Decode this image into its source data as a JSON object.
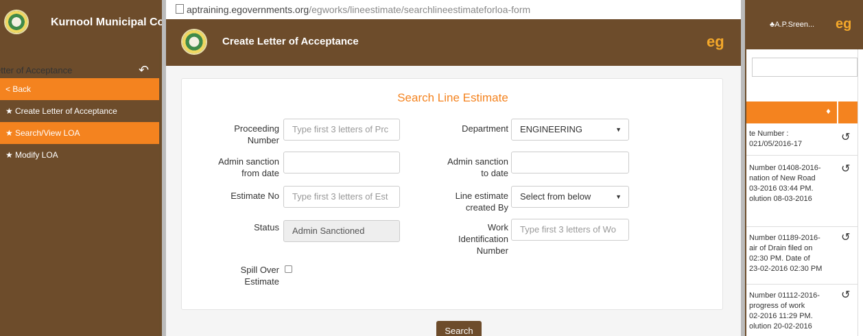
{
  "app": {
    "title": "Kurnool Municipal Co",
    "user": "♣A.P.Sreen...",
    "brand_logo": "eg"
  },
  "sidebar": {
    "heading": "etter of Acceptance",
    "items": [
      {
        "label": "< Back",
        "active": true
      },
      {
        "label": "Create Letter of Acceptance",
        "active": false
      },
      {
        "label": "Search/View LOA",
        "active": true
      },
      {
        "label": "Modify LOA",
        "active": false
      }
    ]
  },
  "browser": {
    "url_host": "aptraining.egovernments.org",
    "url_path": "/egworks/lineestimate/searchlineestimateforloa-form"
  },
  "popup": {
    "title": "Create Letter of Acceptance",
    "brand_logo": "eg"
  },
  "form": {
    "heading": "Search Line Estimate",
    "proceeding_number": {
      "label1": "Proceeding",
      "label2": "Number",
      "placeholder": "Type first 3 letters of Prc"
    },
    "department": {
      "label": "Department",
      "value": "ENGINEERING"
    },
    "admin_from": {
      "label1": "Admin sanction",
      "label2": "from date"
    },
    "admin_to": {
      "label1": "Admin sanction",
      "label2": "to date"
    },
    "estimate_no": {
      "label": "Estimate No",
      "placeholder": "Type first 3 letters of Est"
    },
    "created_by": {
      "label1": "Line estimate",
      "label2": "created By",
      "value": "Select from below"
    },
    "status": {
      "label": "Status",
      "value": "Admin Sanctioned"
    },
    "work_id": {
      "label1": "Work",
      "label2": "Identification",
      "label3": "Number",
      "placeholder": "Type first 3 letters of Wo"
    },
    "spill_over": {
      "label1": "Spill Over",
      "label2": "Estimate"
    },
    "search_button": "Search"
  },
  "background_table": {
    "sort_icon": "♦",
    "rows": [
      {
        "lines": [
          "te Number :",
          "021/05/2016-17"
        ]
      },
      {
        "lines": [
          "Number 01408-2016-",
          "nation of New Road",
          "03-2016 03:44 PM.",
          "olution 08-03-2016"
        ]
      },
      {
        "lines": [
          "Number 01189-2016-",
          "air of Drain filed on",
          " 02:30 PM. Date of",
          "23-02-2016 02:30 PM"
        ]
      },
      {
        "lines": [
          "Number 01112-2016-",
          " progress of work",
          "02-2016 11:29 PM.",
          "olution 20-02-2016"
        ]
      }
    ]
  }
}
